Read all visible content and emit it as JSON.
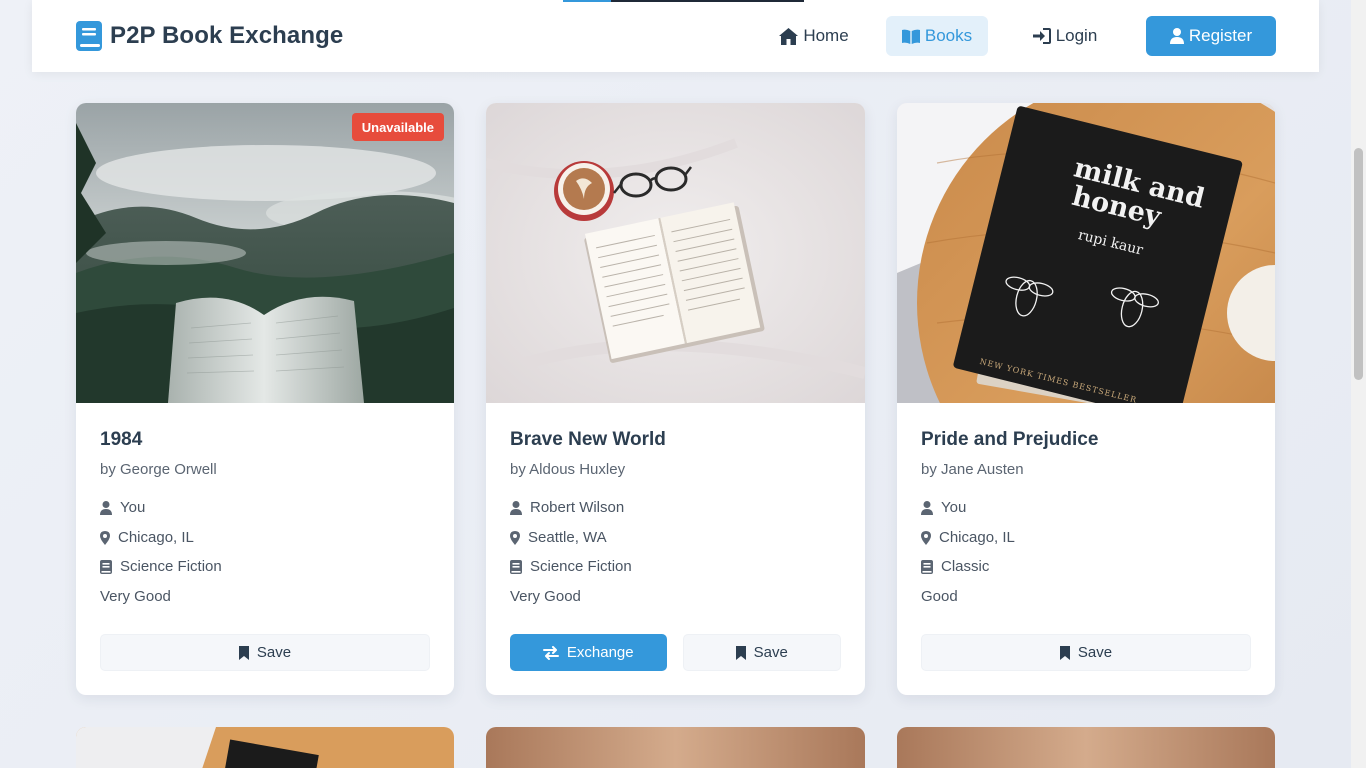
{
  "brand": {
    "title": "P2P Book Exchange"
  },
  "nav": {
    "home": "Home",
    "books": "Books",
    "login": "Login",
    "register": "Register"
  },
  "colors": {
    "accent": "#3498db",
    "unavailable": "#e74c3c",
    "text_dark": "#2c3e50"
  },
  "books": [
    {
      "title": "1984",
      "author": "by George Orwell",
      "owner": "You",
      "location": "Chicago, IL",
      "genre": "Science Fiction",
      "condition": "Very Good",
      "badge": "Unavailable",
      "save_label": "Save"
    },
    {
      "title": "Brave New World",
      "author": "by Aldous Huxley",
      "owner": "Robert Wilson",
      "location": "Seattle, WA",
      "genre": "Science Fiction",
      "condition": "Very Good",
      "exchange_label": "Exchange",
      "save_label": "Save"
    },
    {
      "title": "Pride and Prejudice",
      "author": "by Jane Austen",
      "owner": "You",
      "location": "Chicago, IL",
      "genre": "Classic",
      "condition": "Good",
      "save_label": "Save"
    }
  ],
  "cover_art": {
    "book3_cover_line1": "milk and",
    "book3_cover_line2": "honey",
    "book3_cover_author": "rupi kaur",
    "book3_cover_footer": "NEW YORK TIMES BESTSELLER"
  }
}
